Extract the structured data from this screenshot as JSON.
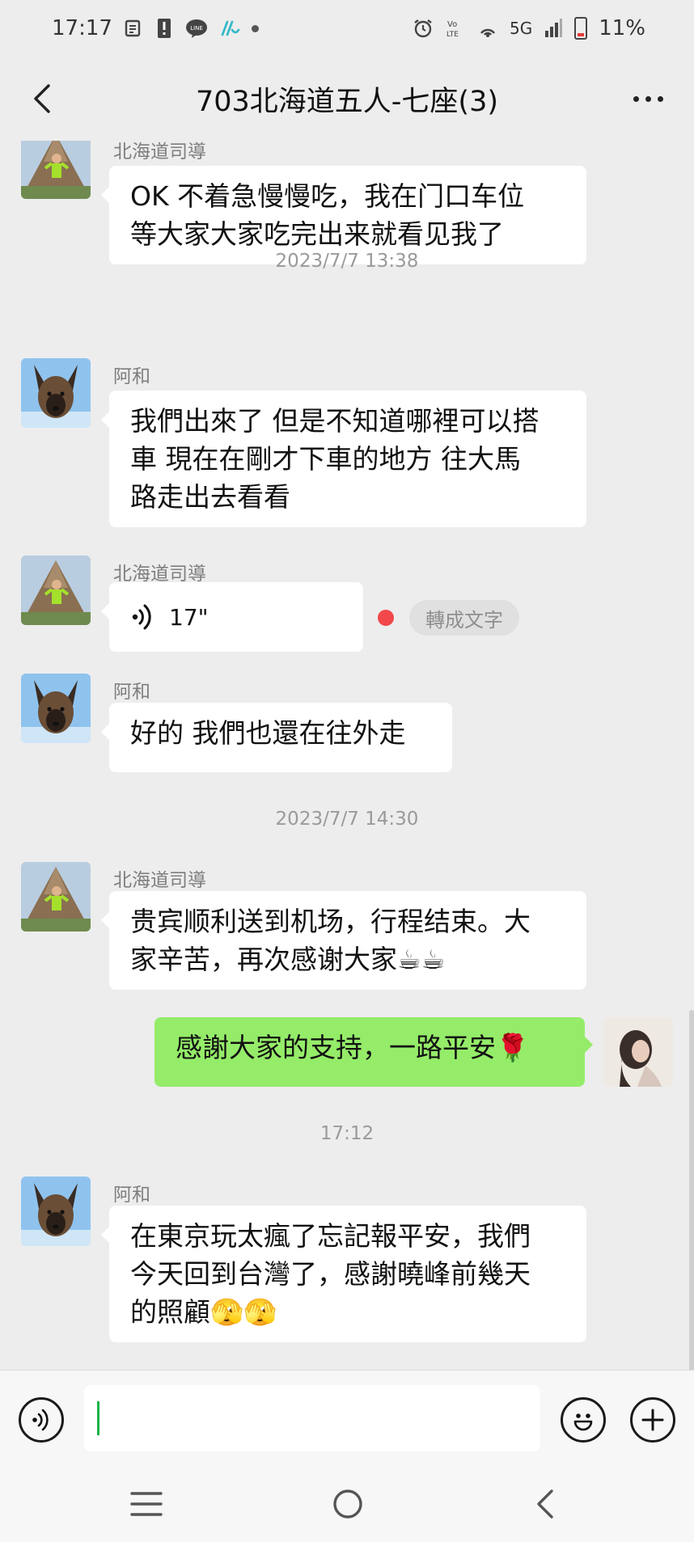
{
  "status_bar": {
    "time": "17:17",
    "network": "5G",
    "battery": "11%",
    "left_icons": [
      "gallery-icon",
      "alert-icon",
      "line-app-icon",
      "taipei-app-icon"
    ],
    "right_icons": [
      "alarm-icon",
      "volte-icon",
      "hotspot-icon",
      "signal-icon",
      "battery-icon"
    ]
  },
  "header": {
    "title": "703北海道五人-七座(3)"
  },
  "messages": [
    {
      "type": "text",
      "side": "left",
      "sender": "北海道司導",
      "text_lines": [
        "OK 不着急慢慢吃，我在门口车位",
        "等大家大家吃完出来就看见我了"
      ]
    },
    {
      "type": "time",
      "text": "2023/7/7 13:38"
    },
    {
      "type": "text",
      "side": "left",
      "sender": "阿和",
      "text_lines": [
        "我們出來了 但是不知道哪裡可以搭",
        "車 現在在剛才下車的地方 往大馬",
        "路走出去看看"
      ]
    },
    {
      "type": "voice",
      "side": "left",
      "sender": "北海道司導",
      "duration": "17\"",
      "unread": true,
      "convert_label": "轉成文字"
    },
    {
      "type": "text",
      "side": "left",
      "sender": "阿和",
      "text_lines": [
        "好的 我們也還在往外走"
      ]
    },
    {
      "type": "time",
      "text": "2023/7/7 14:30"
    },
    {
      "type": "text",
      "side": "left",
      "sender": "北海道司導",
      "text_lines": [
        "贵宾顺利送到机场，行程结束。大",
        "家辛苦，再次感谢大家☕☕"
      ]
    },
    {
      "type": "text",
      "side": "right",
      "sender": "",
      "text_lines": [
        "感謝大家的支持，一路平安🌹"
      ]
    },
    {
      "type": "time",
      "text": "17:12"
    },
    {
      "type": "text",
      "side": "left",
      "sender": "阿和",
      "text_lines": [
        "在東京玩太瘋了忘記報平安，我們",
        "今天回到台灣了，感謝曉峰前幾天",
        "的照顧🫣🫣"
      ]
    }
  ],
  "input_bar": {
    "value": "",
    "placeholder": ""
  },
  "colors": {
    "background": "#ededed",
    "bubble_self": "#95ec69",
    "bubble_other": "#ffffff",
    "unread_dot": "#f2484b",
    "caret": "#19b44b"
  }
}
